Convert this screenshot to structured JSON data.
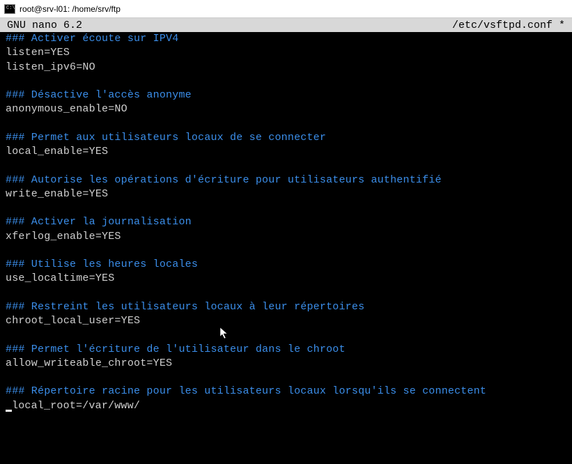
{
  "window": {
    "title": "root@srv-l01: /home/srv/ftp"
  },
  "nano": {
    "app_label": "GNU nano 6.2",
    "file_label": "/etc/vsftpd.conf *"
  },
  "lines": [
    {
      "type": "comment",
      "text": "### Activer écoute sur IPV4"
    },
    {
      "type": "config",
      "text": "listen=YES"
    },
    {
      "type": "config",
      "text": "listen_ipv6=NO"
    },
    {
      "type": "blank",
      "text": ""
    },
    {
      "type": "comment",
      "text": "### Désactive l'accès anonyme"
    },
    {
      "type": "config",
      "text": "anonymous_enable=NO"
    },
    {
      "type": "blank",
      "text": ""
    },
    {
      "type": "comment",
      "text": "### Permet aux utilisateurs locaux de se connecter"
    },
    {
      "type": "config",
      "text": "local_enable=YES"
    },
    {
      "type": "blank",
      "text": ""
    },
    {
      "type": "comment",
      "text": "### Autorise les opérations d'écriture pour utilisateurs authentifié"
    },
    {
      "type": "config",
      "text": "write_enable=YES"
    },
    {
      "type": "blank",
      "text": ""
    },
    {
      "type": "comment",
      "text": "### Activer la journalisation"
    },
    {
      "type": "config",
      "text": "xferlog_enable=YES"
    },
    {
      "type": "blank",
      "text": ""
    },
    {
      "type": "comment",
      "text": "### Utilise les heures locales"
    },
    {
      "type": "config",
      "text": "use_localtime=YES"
    },
    {
      "type": "blank",
      "text": ""
    },
    {
      "type": "comment",
      "text": "### Restreint les utilisateurs locaux à leur répertoires"
    },
    {
      "type": "config",
      "text": "chroot_local_user=YES"
    },
    {
      "type": "blank",
      "text": ""
    },
    {
      "type": "comment",
      "text": "### Permet l'écriture de l'utilisateur dans le chroot"
    },
    {
      "type": "config",
      "text": "allow_writeable_chroot=YES"
    },
    {
      "type": "blank",
      "text": ""
    },
    {
      "type": "comment",
      "text": "### Répertoire racine pour les utilisateurs locaux lorsqu'ils se connectent"
    },
    {
      "type": "config",
      "text": "local_root=/var/www/",
      "cursor": true
    }
  ]
}
